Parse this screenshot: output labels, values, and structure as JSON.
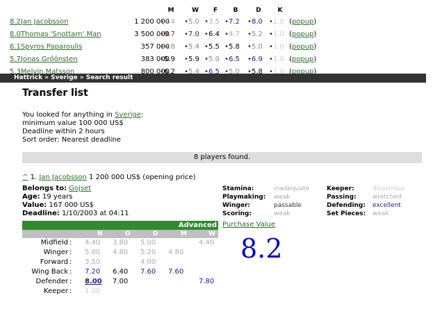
{
  "summary": {
    "headers": [
      "M",
      "W",
      "F",
      "B",
      "D",
      "K"
    ],
    "rows": [
      {
        "score": "8.2",
        "name": "Jan Jacobsson",
        "price": "1 200 000",
        "vals": [
          [
            "4.4",
            "v-dim"
          ],
          [
            "5.0",
            "v-gray"
          ],
          [
            "3.5",
            "v-dim"
          ],
          [
            "7.2",
            "v-blue"
          ],
          [
            "8.0",
            "v-blue"
          ],
          [
            "1.0",
            "v-vdim"
          ]
        ],
        "popup": "popup"
      },
      {
        "score": "8.0",
        "name": "Thomas 'Snottarn' Man",
        "price": "3 500 000",
        "vals": [
          [
            "9.7",
            "v-red"
          ],
          [
            "7.0",
            "v-blue"
          ],
          [
            "6.4",
            "v-dark"
          ],
          [
            "4.7",
            "v-dim"
          ],
          [
            "5.2",
            "v-gray"
          ],
          [
            "1.0",
            "v-vdim"
          ]
        ],
        "popup": "popup"
      },
      {
        "score": "6.1",
        "name": "Spyros Paparoulis",
        "price": "357 000",
        "vals": [
          [
            "4.8",
            "v-gray"
          ],
          [
            "5.4",
            "v-gray"
          ],
          [
            "5.5",
            "v-dark"
          ],
          [
            "5.8",
            "v-dark"
          ],
          [
            "5.0",
            "v-gray"
          ],
          [
            "1.0",
            "v-vdim"
          ]
        ],
        "popup": "popup"
      },
      {
        "score": "5.7",
        "name": "Jonas Gröönsten",
        "price": "383 000",
        "vals": [
          [
            "5.9",
            "v-dark"
          ],
          [
            "5.9",
            "v-dark"
          ],
          [
            "5.0",
            "v-gray"
          ],
          [
            "6.5",
            "v-blue"
          ],
          [
            "6.9",
            "v-blue"
          ],
          [
            "1.0",
            "v-vdim"
          ]
        ],
        "popup": "popup"
      },
      {
        "score": "5.3",
        "name": "Melvin Matsson",
        "price": "800 000",
        "vals": [
          [
            "6.2",
            "v-dark"
          ],
          [
            "5.4",
            "v-gray"
          ],
          [
            "6.5",
            "v-blue"
          ],
          [
            "5.0",
            "v-gray"
          ],
          [
            "5.8",
            "v-dark"
          ],
          [
            "1.0",
            "v-vdim"
          ]
        ],
        "popup": "popup"
      }
    ]
  },
  "breadcrumb": "Hattrick » Sverige » Search result",
  "title": "Transfer list",
  "criteria": {
    "line1_prefix": "You looked for anything in ",
    "line1_link": "Sverige",
    "line1_suffix": ":",
    "line2": "minimum value 100 000 US$",
    "line3": "Deadline within 2 hours",
    "line4": "Sort order: Nearest deadline"
  },
  "found": "8 players found.",
  "player": {
    "caret": "^",
    "index": "1.",
    "name": "Jan Jacobsson",
    "price": "1 200 000 US$ (opening price)",
    "belongs_label": "Belongs to:",
    "belongs": "Gojset",
    "age_label": "Age:",
    "age": "19 years",
    "value_label": "Value:",
    "value": "167 000 US$",
    "deadline_label": "Deadline:",
    "deadline": "1/10/2003 at 04:11"
  },
  "skills": [
    {
      "label": "Stamina:",
      "value": "inadequate",
      "color": "#aaaaaa"
    },
    {
      "label": "Keeper:",
      "value": "disastrous",
      "color": "#cccccc"
    },
    {
      "label": "Playmaking:",
      "value": "weak",
      "color": "#aaaaaa"
    },
    {
      "label": "Passing:",
      "value": "wretched",
      "color": "#aaaaaa"
    },
    {
      "label": "Winger:",
      "value": "passable",
      "color": "#333333"
    },
    {
      "label": "Defending:",
      "value": "excellent",
      "color": "#1a1a8b"
    },
    {
      "label": "Scoring:",
      "value": "weak",
      "color": "#aaaaaa"
    },
    {
      "label": "Set Pieces:",
      "value": "weak",
      "color": "#aaaaaa"
    }
  ],
  "advanced": {
    "title": "Advanced",
    "cols": [
      "N",
      "O",
      "D",
      "M",
      "W"
    ],
    "rows": [
      {
        "label": "Midfield",
        "vals": [
          [
            "4.40",
            "#aaa"
          ],
          [
            "3.80",
            "#aaa"
          ],
          [
            "5.00",
            "#aaa"
          ],
          [
            "",
            ""
          ],
          [
            "4.40",
            "#aaa"
          ]
        ]
      },
      {
        "label": "Winger",
        "vals": [
          [
            "5.00",
            "#aaa"
          ],
          [
            "4.80",
            "#aaa"
          ],
          [
            "5.20",
            "#aaa"
          ],
          [
            "4.80",
            "#aaa"
          ],
          [
            "",
            ""
          ]
        ]
      },
      {
        "label": "Forward",
        "vals": [
          [
            "3.50",
            "#aaa"
          ],
          [
            "",
            ""
          ],
          [
            "4.00",
            "#aaa"
          ],
          [
            "",
            ""
          ],
          [
            "",
            ""
          ]
        ]
      },
      {
        "label": "Wing Back",
        "vals": [
          [
            "7.20",
            "#1a1a8b"
          ],
          [
            "6.40",
            "#000"
          ],
          [
            "7.60",
            "#1a1a8b"
          ],
          [
            "7.60",
            "#1a1a8b"
          ],
          [
            "",
            ""
          ]
        ]
      },
      {
        "label": "Defender",
        "vals": [
          [
            "8.00",
            "#1a1a8b"
          ],
          [
            "7.00",
            "#000"
          ],
          [
            "",
            ""
          ],
          [
            "",
            ""
          ],
          [
            "7.80",
            "#1a1a8b"
          ]
        ]
      },
      {
        "label": "Keeper",
        "vals": [
          [
            "1.00",
            "#ccc"
          ],
          [
            "",
            ""
          ],
          [
            "",
            ""
          ],
          [
            "",
            ""
          ],
          [
            "",
            ""
          ]
        ]
      }
    ]
  },
  "purchase": {
    "label": "Purchase Value",
    "value": "8.2"
  }
}
